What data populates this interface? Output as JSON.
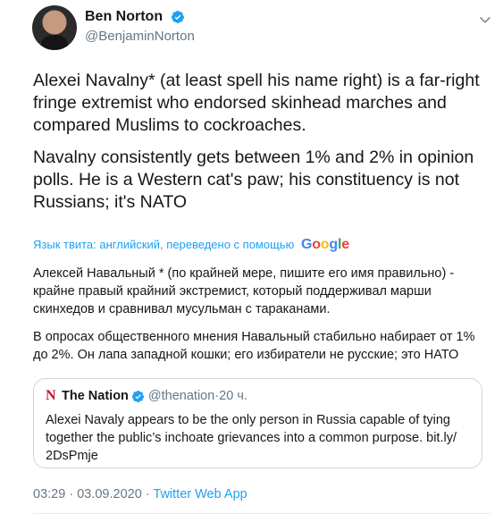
{
  "author": {
    "display_name": "Ben Norton",
    "handle": "@BenjaminNorton",
    "verified": true
  },
  "tweet": {
    "paragraphs": [
      "Alexei Navalny* (at least spell his name right) is a far-right fringe extremist who endorsed skinhead marches and compared Muslims to cockroaches.",
      "Navalny consistently gets between 1% and 2% in opinion polls. He is a Western cat's paw; his constituency is not Russians; it's NATO"
    ]
  },
  "translation": {
    "label": "Язык твита: английский, переведено с помощью",
    "provider_letters": [
      "G",
      "o",
      "o",
      "g",
      "l",
      "e"
    ],
    "paragraphs": [
      "Алексей Навальный * (по крайней мере, пишите его имя правильно) - крайне правый крайний экстремист, который поддерживал марши скинхедов и сравнивал мусульман с тараканами.",
      "В опросах общественного мнения Навальный стабильно набирает от 1% до 2%. Он лапа западной кошки; его избиратели не русские; это НАТО"
    ]
  },
  "quoted_tweet": {
    "logo_letter": "N",
    "name": "The Nation",
    "handle": "@thenation",
    "separator": "·",
    "time": "20 ч.",
    "text": "Alexei Navaly appears to be the only person in Russia capable of tying together the public’s inchoate grievances into a common purpose. bit.ly/ 2DsPmje"
  },
  "meta": {
    "time": "03:29",
    "separator1": " · ",
    "date": "03.09.2020",
    "separator2": " · ",
    "source": "Twitter Web App"
  },
  "colors": {
    "accent": "#1da1f2",
    "muted": "#657786",
    "text": "#14171a",
    "nation_red": "#c8102e"
  },
  "icons": {
    "verified": "verified-badge-icon",
    "caret": "chevron-down-icon"
  }
}
